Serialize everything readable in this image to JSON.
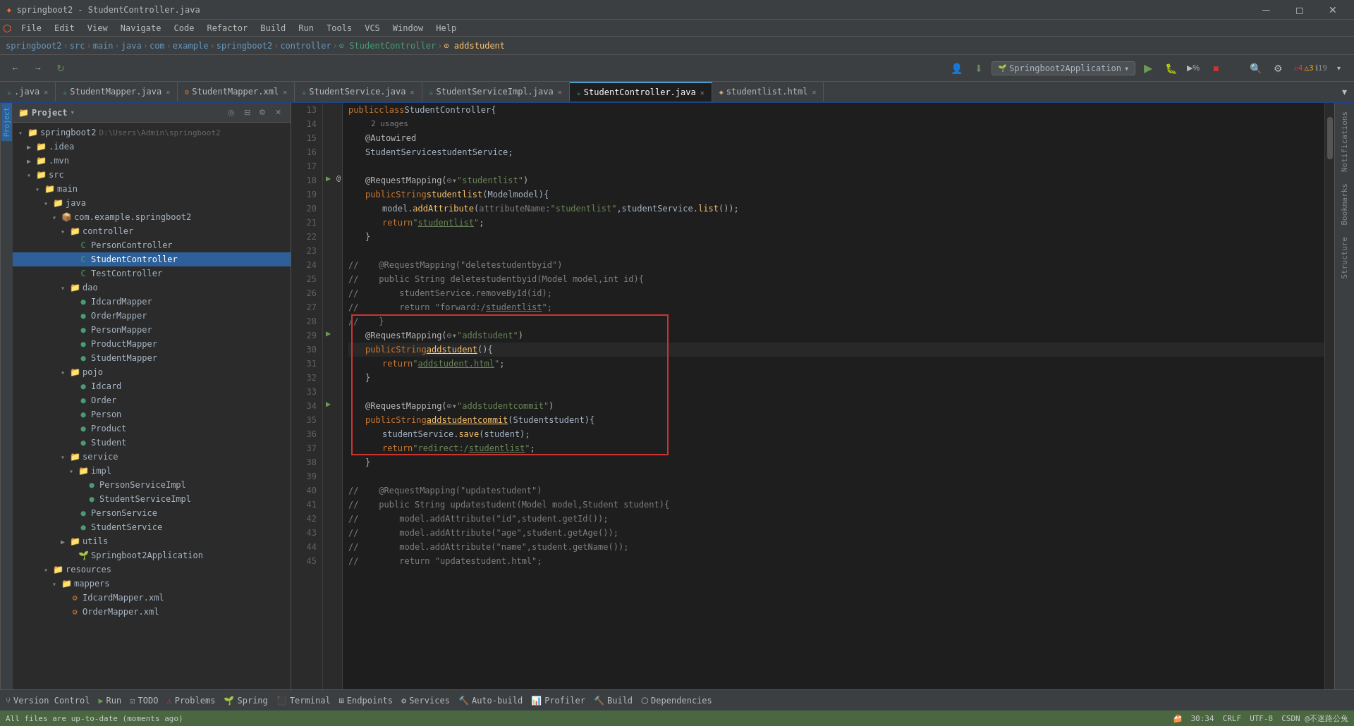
{
  "window": {
    "title": "springboot2 - StudentController.java",
    "controls": [
      "minimize",
      "maximize",
      "close"
    ]
  },
  "menu": {
    "items": [
      "File",
      "Edit",
      "View",
      "Navigate",
      "Code",
      "Refactor",
      "Build",
      "Run",
      "Tools",
      "VCS",
      "Window",
      "Help"
    ]
  },
  "breadcrumb": {
    "parts": [
      "springboot2",
      "src",
      "main",
      "java",
      "com",
      "example",
      "springboot2",
      "controller",
      "StudentController",
      "addstudent"
    ]
  },
  "tabs": [
    {
      "label": ".java",
      "active": false,
      "color": "#4a9b74"
    },
    {
      "label": "StudentMapper.java",
      "active": false,
      "color": "#4a9b74"
    },
    {
      "label": "StudentMapper.xml",
      "active": false,
      "color": "#cc7832"
    },
    {
      "label": "StudentService.java",
      "active": false,
      "color": "#4a9b74"
    },
    {
      "label": "StudentServiceImpl.java",
      "active": false,
      "color": "#4a9b74"
    },
    {
      "label": "StudentController.java",
      "active": true,
      "color": "#4a9b74"
    },
    {
      "label": "studentlist.html",
      "active": false,
      "color": "#e8c57a"
    }
  ],
  "panel": {
    "title": "Project",
    "root": "springboot2",
    "rootPath": "D:\\Users\\Admin\\springboot2"
  },
  "tree": [
    {
      "level": 0,
      "type": "root",
      "label": "springboot2",
      "path": "D:\\Users\\Admin\\springboot2",
      "expanded": true
    },
    {
      "level": 1,
      "type": "folder",
      "label": ".idea",
      "expanded": false
    },
    {
      "level": 1,
      "type": "folder",
      "label": ".mvn",
      "expanded": false
    },
    {
      "level": 1,
      "type": "folder",
      "label": "src",
      "expanded": true
    },
    {
      "level": 2,
      "type": "folder",
      "label": "main",
      "expanded": true
    },
    {
      "level": 3,
      "type": "folder",
      "label": "java",
      "expanded": true
    },
    {
      "level": 4,
      "type": "package",
      "label": "com.example.springboot2",
      "expanded": true
    },
    {
      "level": 5,
      "type": "folder",
      "label": "controller",
      "expanded": true
    },
    {
      "level": 6,
      "type": "java",
      "label": "PersonController",
      "selected": false
    },
    {
      "level": 6,
      "type": "java",
      "label": "StudentController",
      "selected": true
    },
    {
      "level": 6,
      "type": "java",
      "label": "TestController",
      "selected": false
    },
    {
      "level": 5,
      "type": "folder",
      "label": "dao",
      "expanded": true
    },
    {
      "level": 6,
      "type": "java",
      "label": "IdcardMapper",
      "selected": false
    },
    {
      "level": 6,
      "type": "java",
      "label": "OrderMapper",
      "selected": false
    },
    {
      "level": 6,
      "type": "java",
      "label": "PersonMapper",
      "selected": false
    },
    {
      "level": 6,
      "type": "java",
      "label": "ProductMapper",
      "selected": false
    },
    {
      "level": 6,
      "type": "java",
      "label": "StudentMapper",
      "selected": false
    },
    {
      "level": 5,
      "type": "folder",
      "label": "pojo",
      "expanded": true
    },
    {
      "level": 6,
      "type": "java",
      "label": "Idcard",
      "selected": false
    },
    {
      "level": 6,
      "type": "java",
      "label": "Order",
      "selected": false
    },
    {
      "level": 6,
      "type": "java",
      "label": "Person",
      "selected": false
    },
    {
      "level": 6,
      "type": "java",
      "label": "Product",
      "selected": false
    },
    {
      "level": 6,
      "type": "java",
      "label": "Student",
      "selected": false
    },
    {
      "level": 5,
      "type": "folder",
      "label": "service",
      "expanded": true
    },
    {
      "level": 6,
      "type": "folder",
      "label": "impl",
      "expanded": true
    },
    {
      "level": 7,
      "type": "java",
      "label": "PersonServiceImpl",
      "selected": false
    },
    {
      "level": 7,
      "type": "java",
      "label": "StudentServiceImpl",
      "selected": false
    },
    {
      "level": 6,
      "type": "java",
      "label": "PersonService",
      "selected": false
    },
    {
      "level": 6,
      "type": "java",
      "label": "StudentService",
      "selected": false
    },
    {
      "level": 5,
      "type": "folder",
      "label": "utils",
      "expanded": false
    },
    {
      "level": 6,
      "type": "spring",
      "label": "Springboot2Application",
      "selected": false
    },
    {
      "level": 3,
      "type": "folder",
      "label": "resources",
      "expanded": true
    },
    {
      "level": 4,
      "type": "folder",
      "label": "mappers",
      "expanded": true
    },
    {
      "level": 5,
      "type": "xml",
      "label": "IdcardMapper.xml",
      "selected": false
    },
    {
      "level": 5,
      "type": "xml",
      "label": "OrderMapper.xml",
      "selected": false
    }
  ],
  "code": {
    "lines": [
      {
        "num": 13,
        "text": "public class StudentController {",
        "indent": 0
      },
      {
        "num": 14,
        "text": "    2 usages",
        "hint": true
      },
      {
        "num": 15,
        "text": "    @Autowired",
        "indent": 4
      },
      {
        "num": 16,
        "text": "    StudentService studentService;",
        "indent": 4
      },
      {
        "num": 17,
        "text": ""
      },
      {
        "num": 18,
        "text": "    @RequestMapping(☉▾\"studentlist\")",
        "indent": 4
      },
      {
        "num": 19,
        "text": "    public String studentlist(Model model){",
        "indent": 4
      },
      {
        "num": 20,
        "text": "        model.addAttribute( attributeName: \"studentlist\",studentService.list());",
        "indent": 8
      },
      {
        "num": 21,
        "text": "        return \"studentlist\";",
        "indent": 8
      },
      {
        "num": 22,
        "text": "    }",
        "indent": 4
      },
      {
        "num": 23,
        "text": ""
      },
      {
        "num": 24,
        "text": "//    @RequestMapping(\"deletestudentbyid\")",
        "comment": true
      },
      {
        "num": 25,
        "text": "//    public String deletestudentbyid(Model model,int id){",
        "comment": true
      },
      {
        "num": 26,
        "text": "//        studentService.removeById(id);",
        "comment": true
      },
      {
        "num": 27,
        "text": "//        return \"forward:/studentlist\";",
        "comment": true
      },
      {
        "num": 28,
        "text": "//    }",
        "comment": true
      },
      {
        "num": 29,
        "text": "    @RequestMapping(☉▾\"addstudent\")",
        "indent": 4
      },
      {
        "num": 30,
        "text": "    public String addstudent(){",
        "indent": 4
      },
      {
        "num": 31,
        "text": "        return \"addstudent.html\";",
        "indent": 8
      },
      {
        "num": 32,
        "text": "    }",
        "indent": 4
      },
      {
        "num": 33,
        "text": ""
      },
      {
        "num": 34,
        "text": "    @RequestMapping(☉▾\"addstudentcommit\")",
        "indent": 4
      },
      {
        "num": 35,
        "text": "    public String addstudentcommit(Student student){",
        "indent": 4
      },
      {
        "num": 36,
        "text": "        studentService.save(student);",
        "indent": 8
      },
      {
        "num": 37,
        "text": "        return \"redirect:/studentlist\";",
        "indent": 8
      },
      {
        "num": 38,
        "text": "    }",
        "indent": 4
      },
      {
        "num": 39,
        "text": ""
      },
      {
        "num": 40,
        "text": "//    @RequestMapping(\"updatestudent\")",
        "comment": true
      },
      {
        "num": 41,
        "text": "//    public String updatestudent(Model model,Student student){",
        "comment": true
      },
      {
        "num": 42,
        "text": "//        model.addAttribute(\"id\",student.getId());",
        "comment": true
      },
      {
        "num": 43,
        "text": "//        model.addAttribute(\"age\",student.getAge());",
        "comment": true
      },
      {
        "num": 44,
        "text": "//        model.addAttribute(\"name\",student.getName());",
        "comment": true
      },
      {
        "num": 45,
        "text": "//        return \"updatestudent.html\";",
        "comment": true
      }
    ]
  },
  "status": {
    "message": "All files are up-to-date (moments ago)",
    "cursor": "30:34",
    "encoding": "CRLF",
    "charset": "UTF-8",
    "context": "🍰",
    "warnings": {
      "errors": 4,
      "warnings": 3,
      "info": 19
    },
    "tools": [
      "Version Control",
      "Run",
      "TODO",
      "Problems",
      "Spring",
      "Terminal",
      "Endpoints",
      "Services",
      "Auto-build",
      "Profiler",
      "Build",
      "Dependencies"
    ]
  },
  "run_config": {
    "label": "Springboot2Application"
  }
}
